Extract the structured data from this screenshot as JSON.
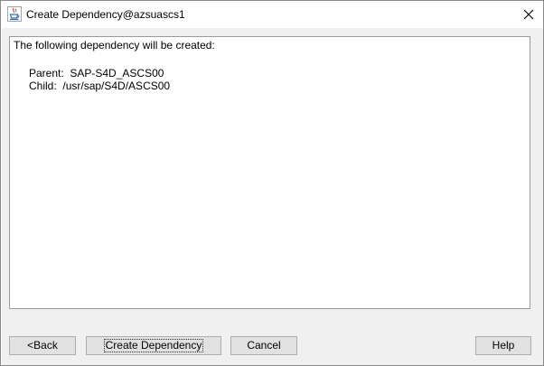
{
  "window": {
    "title": "Create Dependency@azsuascs1",
    "app_icon": "java-cup-icon",
    "close_icon": "close-icon"
  },
  "message": {
    "intro": "The following dependency will be created:",
    "parent_label": "Parent:",
    "parent_value": "SAP-S4D_ASCS00",
    "child_label": "Child:",
    "child_value": "/usr/sap/S4D/ASCS00"
  },
  "buttons": {
    "back": "<Back",
    "create": "Create Dependency",
    "cancel": "Cancel",
    "help": "Help"
  },
  "colors": {
    "dialog_background": "#f0f0f0",
    "panel_background": "#ffffff",
    "button_face": "#e1e1e1"
  }
}
